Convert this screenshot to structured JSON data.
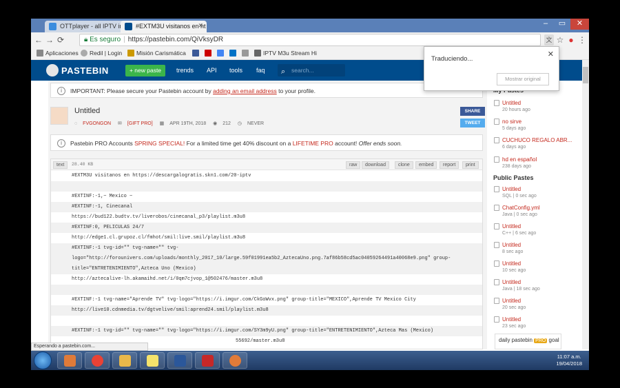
{
  "browser": {
    "tabs": [
      {
        "label": "OTTplayer - all IPTV in o"
      },
      {
        "label": "#EXTM3U visitanos en ht"
      }
    ],
    "window_controls": [
      "–",
      "▭",
      "✕"
    ],
    "url_secure": "Es seguro",
    "url": "https://pastebin.com/QiVksyDR",
    "bookmarks": [
      {
        "label": "Aplicaciones",
        "color": "#d44"
      },
      {
        "label": "Redil | Login",
        "color": "#888"
      },
      {
        "label": "Misión Carismática",
        "color": "#c90"
      },
      {
        "label": "",
        "color": "#3b5998"
      },
      {
        "label": "",
        "color": "#c00"
      },
      {
        "label": "",
        "color": "#4285f4"
      },
      {
        "label": "",
        "color": "#0072c6"
      },
      {
        "label": "",
        "color": "#999"
      },
      {
        "label": "IPTV M3u Stream Hi",
        "color": "#666"
      }
    ],
    "status_text": "Esperando a pastebin.com..."
  },
  "pastebin": {
    "logo": "PASTEBIN",
    "new_paste": "+ new paste",
    "nav": [
      "trends",
      "API",
      "tools",
      "faq"
    ],
    "search_placeholder": "search..."
  },
  "notice1": {
    "prefix": "IMPORTANT: Please secure your Pastebin account by ",
    "link": "adding an email address",
    "suffix": " to your profile."
  },
  "paste": {
    "title": "Untitled",
    "author": "FVGONGON",
    "badge": "[GIFT PRO]",
    "date": "APR 19TH, 2018",
    "views": "212",
    "expires": "NEVER",
    "share": "SHARE",
    "tweet": "TWEET"
  },
  "notice2": {
    "prefix": "Pastebin PRO Accounts ",
    "special": "SPRING SPECIAL!",
    "mid": " For a limited time get 40% discount on a ",
    "lifetime": "LIFETIME PRO",
    "suffix": " account! ",
    "ends": "Offer ends soon."
  },
  "code": {
    "format": "text",
    "size": "28.40 KB",
    "buttons": [
      "raw",
      "download",
      "clone",
      "embed",
      "report",
      "print"
    ],
    "lines": [
      "#EXTM3U visitanos en https://descargalogratis.skn1.com/20-iptv",
      "",
      "#EXTINF:-1,~ Mexico ~",
      "#EXTINF:-1, Cinecanal",
      "https://bud122.budtv.tv/liverobos/cinecanal_p3/playlist.m3u8",
      "#EXTINF:0, PELICULAS 24/7",
      "http://edge1.cl.grupoz.cl/fmhot/smil:live.smil/playlist.m3u8",
      "#EXTINF:-1 tvg-id=\"\" tvg-name=\"\" tvg-",
      "logo=\"http://forounivers.com/uploads/monthly_2017_10/large.59f01991ea5b2_AztecaUno.png.7af86b58cd5ac04059264491a40068e9.png\" group-",
      "title=\"ENTRETENIMIENTO\",Azteca Uno (Mexico)",
      "http://aztecalive-lh.akamaihd.net/i/0qm7cjvop_1@502476/master.m3u8",
      "",
      "#EXTINF:-1 tvg-name=\"Aprende TV\" tvg-logo=\"https://i.imgur.com/CkGoWvx.png\" group-title=\"MEXICO\",Aprende TV Mexico City",
      "http://live10.cdnmedia.tv/dgtvelive/smil:aprend24.smil/playlist.m3u8",
      "",
      "#EXTINF:-1 tvg-id=\"\" tvg-name=\"\" tvg-logo=\"https://i.imgur.com/SY3m9yU.png\" group-title=\"ENTRETENIMIENTO\",Azteca Mas (Mexico)",
      "55692/master.m3u8"
    ]
  },
  "sidebar": {
    "my_pastes_title": "My Pastes",
    "my_pastes": [
      {
        "title": "Untitled",
        "meta": "20 hours ago"
      },
      {
        "title": "no sirve",
        "meta": "5 days ago"
      },
      {
        "title": "CUCHUCO REGALO ABR...",
        "meta": "6 days ago"
      },
      {
        "title": "hd en español",
        "meta": "238 days ago"
      }
    ],
    "public_title": "Public Pastes",
    "public": [
      {
        "title": "Untitled",
        "meta": "SQL | 0 sec ago"
      },
      {
        "title": "ChatConfig.yml",
        "meta": "Java | 0 sec ago"
      },
      {
        "title": "Untitled",
        "meta": "C++ | 6 sec ago"
      },
      {
        "title": "Untitled",
        "meta": "8 sec ago"
      },
      {
        "title": "Untitled",
        "meta": "10 sec ago"
      },
      {
        "title": "Untitled",
        "meta": "Java | 18 sec ago"
      },
      {
        "title": "Untitled",
        "meta": "20 sec ago"
      },
      {
        "title": "Untitled",
        "meta": "23 sec ago"
      }
    ],
    "daily_prefix": "daily pastebin ",
    "daily_pro": "PRO",
    "daily_suffix": " goal"
  },
  "translate": {
    "text": "Traduciendo...",
    "button": "Mostrar original"
  },
  "taskbar": {
    "time": "11:07 a.m.",
    "date": "19/04/2018",
    "apps": [
      {
        "name": "chrome",
        "color": "#e94235"
      },
      {
        "name": "explorer",
        "color": "#e9b84a"
      },
      {
        "name": "sticky-notes",
        "color": "#f5e36b"
      },
      {
        "name": "word",
        "color": "#2b579a"
      },
      {
        "name": "iptv",
        "color": "#c62828"
      },
      {
        "name": "app",
        "color": "#e07b39"
      }
    ]
  }
}
